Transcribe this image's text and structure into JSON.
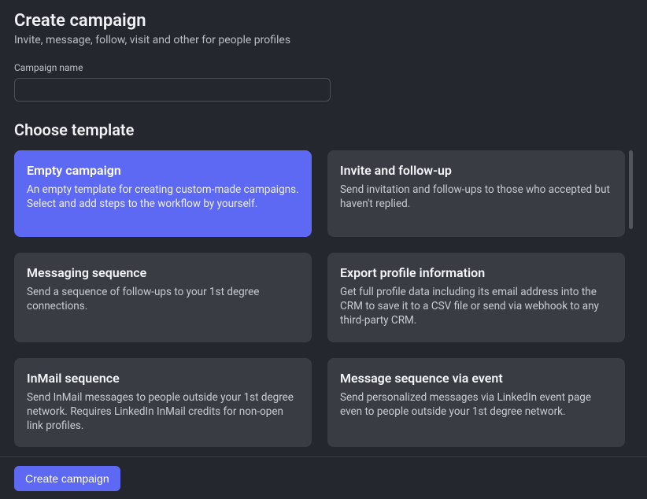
{
  "header": {
    "title": "Create campaign",
    "subtitle": "Invite, message, follow, visit and other for people profiles"
  },
  "form": {
    "campaign_name_label": "Campaign name",
    "campaign_name_value": ""
  },
  "templates": {
    "section_title": "Choose template",
    "items": [
      {
        "title": "Empty campaign",
        "desc": "An empty template for creating custom-made campaigns. Select and add steps to the workflow by yourself.",
        "selected": true
      },
      {
        "title": "Invite and follow-up",
        "desc": "Send invitation and follow-ups to those who accepted but haven't replied.",
        "selected": false
      },
      {
        "title": "Messaging sequence",
        "desc": "Send a sequence of follow-ups to your 1st degree connections.",
        "selected": false
      },
      {
        "title": "Export profile information",
        "desc": "Get full profile data including its email address into the CRM to save it to a CSV file or send via webhook to any third-party CRM.",
        "selected": false
      },
      {
        "title": "InMail sequence",
        "desc": "Send InMail messages to people outside your 1st degree network. Requires LinkedIn InMail credits for non-open link profiles.",
        "selected": false
      },
      {
        "title": "Message sequence via event",
        "desc": "Send personalized messages via LinkedIn event page even to people outside your 1st degree network.",
        "selected": false
      }
    ]
  },
  "footer": {
    "create_label": "Create campaign"
  }
}
